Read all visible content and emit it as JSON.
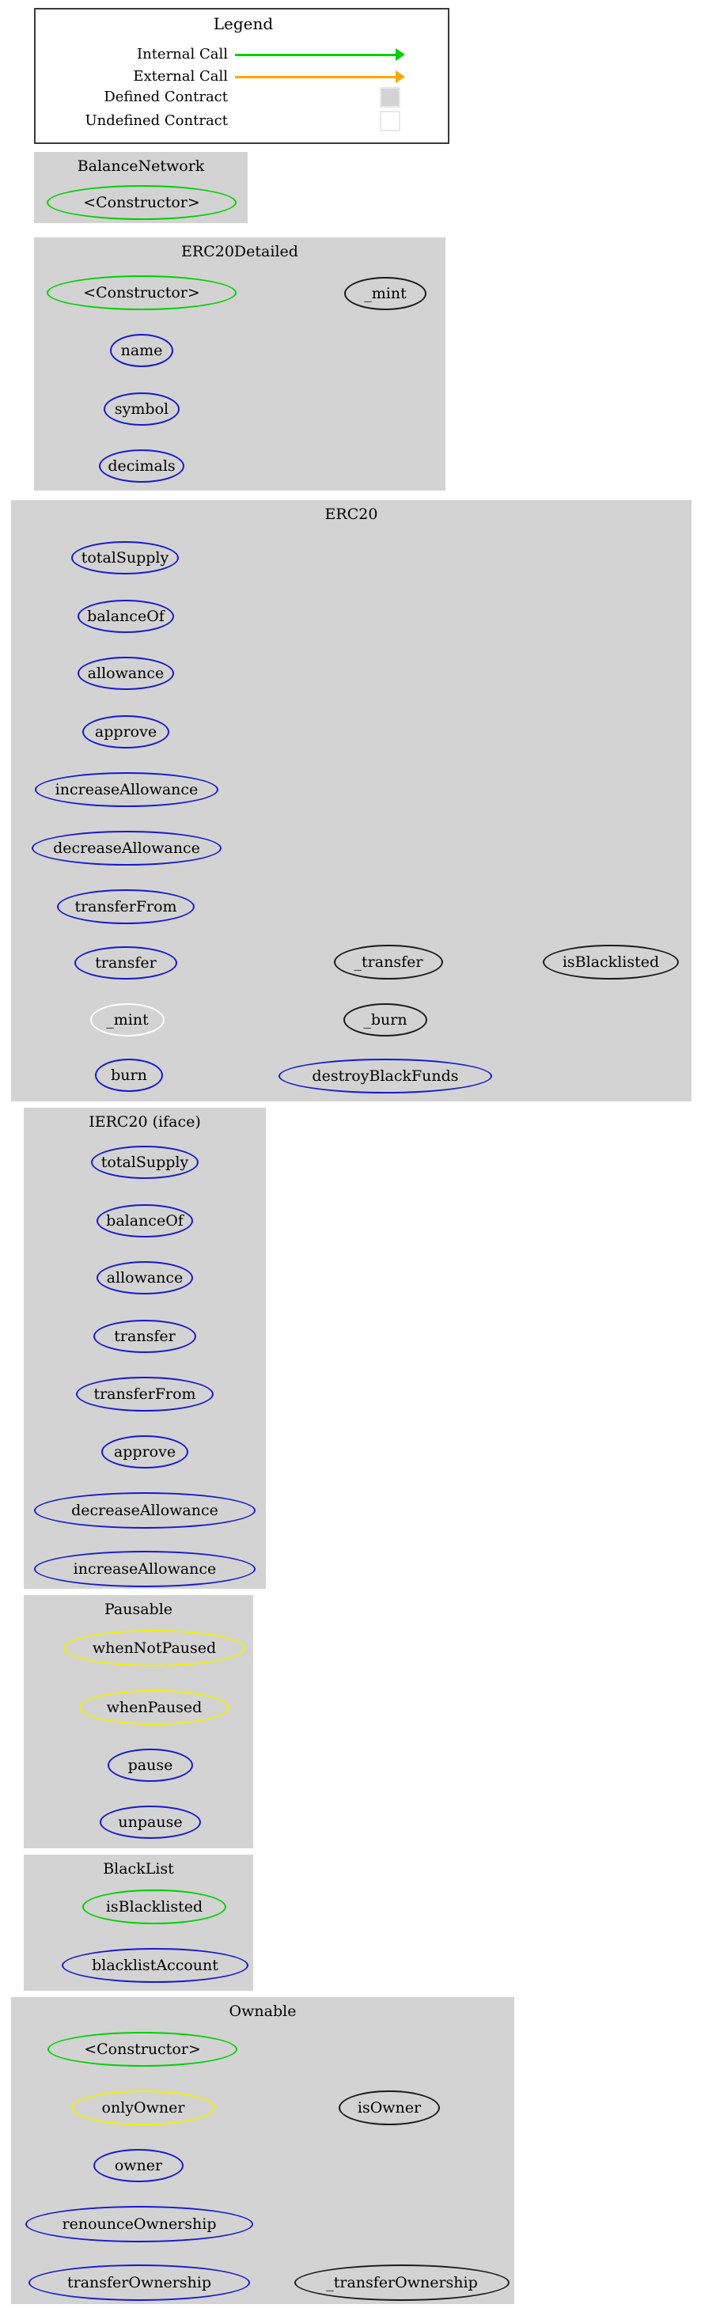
{
  "legend": {
    "title": "Legend",
    "colors": {
      "internal": "#00d000",
      "external": "#ffa500",
      "defined_fill": "#d3d3d3",
      "undefined_fill": "#ffffff",
      "swatch_border": "#e8e8e8",
      "box_border": "#3a3a3a"
    },
    "rows": [
      {
        "label": "Internal Call",
        "kind": "arrow",
        "color": "#00d000"
      },
      {
        "label": "External Call",
        "kind": "arrow",
        "color": "#ffa500"
      },
      {
        "label": "Defined Contract",
        "kind": "swatch",
        "color": "#d3d3d3"
      },
      {
        "label": "Undefined Contract",
        "kind": "swatch",
        "color": "#ffffff"
      }
    ]
  },
  "clusters": [
    {
      "id": "balancenetwork",
      "title": "BalanceNetwork",
      "nodes": [
        {
          "label": "<Constructor>",
          "style": "green"
        }
      ]
    },
    {
      "id": "erc20detailed",
      "title": "ERC20Detailed",
      "nodes": [
        {
          "label": "<Constructor>",
          "style": "green"
        },
        {
          "label": "_mint",
          "style": "black"
        },
        {
          "label": "name",
          "style": "blue"
        },
        {
          "label": "symbol",
          "style": "blue"
        },
        {
          "label": "decimals",
          "style": "blue"
        }
      ]
    },
    {
      "id": "erc20",
      "title": "ERC20",
      "nodes": [
        {
          "label": "totalSupply",
          "style": "blue"
        },
        {
          "label": "balanceOf",
          "style": "blue"
        },
        {
          "label": "allowance",
          "style": "blue"
        },
        {
          "label": "approve",
          "style": "blue"
        },
        {
          "label": "increaseAllowance",
          "style": "blue"
        },
        {
          "label": "decreaseAllowance",
          "style": "blue"
        },
        {
          "label": "transferFrom",
          "style": "blue"
        },
        {
          "label": "transfer",
          "style": "blue"
        },
        {
          "label": "_transfer",
          "style": "black"
        },
        {
          "label": "isBlacklisted",
          "style": "black"
        },
        {
          "label": "_mint",
          "style": "white"
        },
        {
          "label": "_burn",
          "style": "black"
        },
        {
          "label": "burn",
          "style": "blue"
        },
        {
          "label": "destroyBlackFunds",
          "style": "blue"
        }
      ]
    },
    {
      "id": "ierc20",
      "title": "IERC20  (iface)",
      "nodes": [
        {
          "label": "totalSupply",
          "style": "blue"
        },
        {
          "label": "balanceOf",
          "style": "blue"
        },
        {
          "label": "allowance",
          "style": "blue"
        },
        {
          "label": "transfer",
          "style": "blue"
        },
        {
          "label": "transferFrom",
          "style": "blue"
        },
        {
          "label": "approve",
          "style": "blue"
        },
        {
          "label": "decreaseAllowance",
          "style": "blue"
        },
        {
          "label": "increaseAllowance",
          "style": "blue"
        }
      ]
    },
    {
      "id": "pausable",
      "title": "Pausable",
      "nodes": [
        {
          "label": "whenNotPaused",
          "style": "yellow"
        },
        {
          "label": "whenPaused",
          "style": "yellow"
        },
        {
          "label": "pause",
          "style": "blue"
        },
        {
          "label": "unpause",
          "style": "blue"
        }
      ]
    },
    {
      "id": "blacklist",
      "title": "BlackList",
      "nodes": [
        {
          "label": "isBlacklisted",
          "style": "green"
        },
        {
          "label": "blacklistAccount",
          "style": "blue"
        }
      ]
    },
    {
      "id": "ownable",
      "title": "Ownable",
      "nodes": [
        {
          "label": "<Constructor>",
          "style": "green"
        },
        {
          "label": "onlyOwner",
          "style": "yellow"
        },
        {
          "label": "isOwner",
          "style": "black"
        },
        {
          "label": "owner",
          "style": "blue"
        },
        {
          "label": "renounceOwnership",
          "style": "blue"
        },
        {
          "label": "transferOwnership",
          "style": "blue"
        },
        {
          "label": "_transferOwnership",
          "style": "black"
        }
      ]
    }
  ],
  "edges": [
    {
      "from": "ERC20Detailed.<Constructor>",
      "to": "ERC20Detailed._mint",
      "type": "internal"
    },
    {
      "from": "ERC20.transferFrom",
      "to": "ERC20._transfer",
      "type": "internal"
    },
    {
      "from": "ERC20.transfer",
      "to": "ERC20._transfer",
      "type": "internal"
    },
    {
      "from": "ERC20._transfer",
      "to": "ERC20.isBlacklisted",
      "type": "internal"
    },
    {
      "from": "ERC20._transfer",
      "to": "ERC20.isBlacklisted",
      "type": "internal"
    },
    {
      "from": "ERC20.burn",
      "to": "ERC20._burn",
      "type": "internal"
    },
    {
      "from": "ERC20.destroyBlackFunds",
      "to": "ERC20.isBlacklisted",
      "type": "internal"
    },
    {
      "from": "Ownable.onlyOwner",
      "to": "Ownable.isOwner",
      "type": "internal"
    },
    {
      "from": "Ownable.transferOwnership",
      "to": "Ownable._transferOwnership",
      "type": "internal"
    }
  ]
}
